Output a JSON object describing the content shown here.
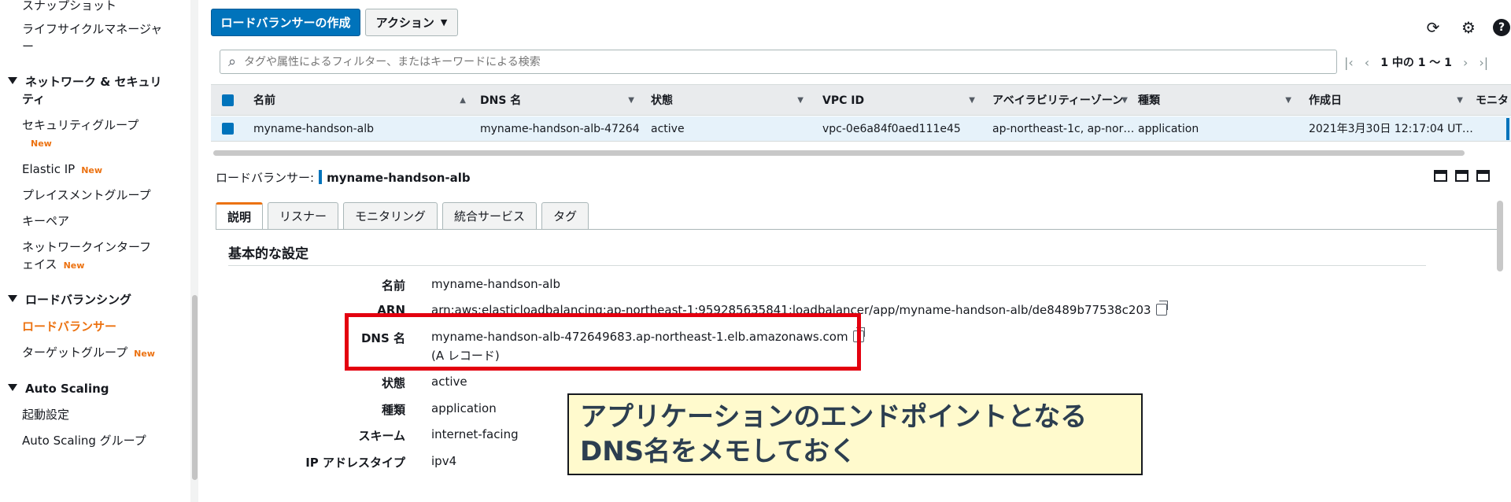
{
  "sidebar": {
    "items": [
      {
        "label": "スナップショット"
      },
      {
        "label": "ライフサイクルマネージャ"
      },
      {
        "label": "ー"
      }
    ],
    "network_section": {
      "label_line1": "ネットワーク & セキュリ",
      "label_line2": "ティ"
    },
    "network_items": {
      "security_groups": "セキュリティグループ",
      "security_groups_badge": "New",
      "elastic_ip": "Elastic IP",
      "elastic_ip_badge": "New",
      "placement_groups": "プレイスメントグループ",
      "key_pairs": "キーペア",
      "network_interfaces_line1": "ネットワークインターフ",
      "network_interfaces_line2": "ェイス",
      "network_interfaces_badge": "New"
    },
    "lb_section": {
      "label": "ロードバランシング"
    },
    "lb_items": {
      "load_balancers": "ロードバランサー",
      "target_groups": "ターゲットグループ",
      "target_groups_badge": "New"
    },
    "as_section": {
      "label": "Auto Scaling"
    },
    "as_items": {
      "launch_configs": "起動設定",
      "as_groups": "Auto Scaling グループ"
    }
  },
  "toolbar": {
    "create_label": "ロードバランサーの作成",
    "action_label": "アクション",
    "refresh_icon": "refresh-icon",
    "settings_icon": "gear-icon",
    "help_icon": "help-icon"
  },
  "search": {
    "placeholder": "タグや属性によるフィルター、またはキーワードによる検索"
  },
  "pager": {
    "text": "1 中の 1 〜 1"
  },
  "table": {
    "headers": [
      "名前",
      "DNS 名",
      "状態",
      "VPC ID",
      "アベイラビリティーゾーン",
      "種類",
      "作成日",
      "モニタ"
    ],
    "row": [
      "myname-handson-alb",
      "myname-handson-alb-47264…",
      "active",
      "vpc-0e6a84f0aed111e45",
      "ap-northeast-1c, ap-nor…",
      "application",
      "2021年3月30日 12:17:04 UT…"
    ]
  },
  "detail": {
    "title_prefix": "ロードバランサー:",
    "title_name": "myname-handson-alb",
    "tabs": [
      "説明",
      "リスナー",
      "モニタリング",
      "統合サービス",
      "タグ"
    ],
    "section_title": "基本的な設定",
    "fields": [
      {
        "label": "名前",
        "value": "myname-handson-alb"
      },
      {
        "label": "ARN",
        "value": "arn:aws:elasticloadbalancing:ap-northeast-1:959285635841:loadbalancer/app/myname-handson-alb/de8489b77538c203"
      },
      {
        "label": "DNS 名",
        "value": "myname-handson-alb-472649683.ap-northeast-1.elb.amazonaws.com",
        "sub": "(A レコード)"
      },
      {
        "label": "状態",
        "value": "active"
      },
      {
        "label": "種類",
        "value": "application"
      },
      {
        "label": "スキーム",
        "value": "internet-facing"
      },
      {
        "label": "IP アドレスタイプ",
        "value": "ipv4"
      }
    ]
  },
  "callout": {
    "line1": "アプリケーションのエンドポイントとなる",
    "line2": "DNS名をメモしておく"
  }
}
